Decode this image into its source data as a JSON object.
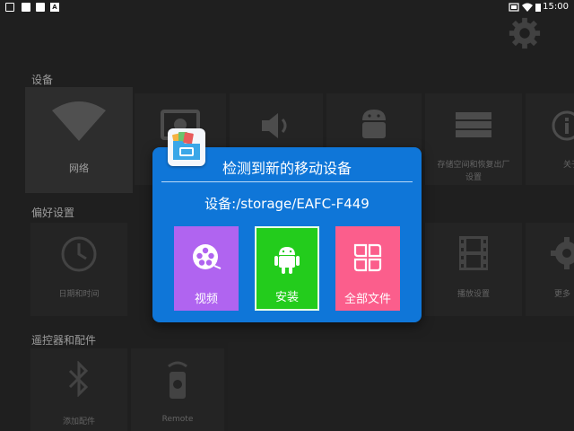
{
  "status_bar": {
    "left_badge_text": "A",
    "time": "15:00"
  },
  "sections": {
    "device": "设备",
    "preferences": "偏好设置",
    "remote": "遥控器和配件"
  },
  "device_tiles": [
    {
      "label": "网络",
      "icon": "wifi-icon"
    },
    {
      "label": "",
      "icon": "display-icon"
    },
    {
      "label": "",
      "icon": "volume-icon"
    },
    {
      "label": "",
      "icon": "android-icon"
    },
    {
      "label": "存储空间和恢复出厂设置",
      "label_line1": "存储空间和恢复出厂",
      "label_line2": "设置",
      "icon": "storage-icon"
    },
    {
      "label": "关于",
      "label_partial": "关于",
      "icon": "info-icon"
    }
  ],
  "preference_tiles": [
    {
      "label": "日期和时间",
      "icon": "clock-icon"
    },
    {
      "label": "播放设置",
      "icon": "film-icon"
    },
    {
      "label": "更多设置",
      "label_partial": "更多",
      "icon": "gear-icon"
    }
  ],
  "remote_tiles": [
    {
      "label": "添加配件",
      "icon": "bluetooth-icon"
    },
    {
      "label": "Remote",
      "icon": "remote-icon"
    }
  ],
  "dialog": {
    "title": "检测到新的移动设备",
    "device": "设备:/storage/EAFC-F449",
    "actions": [
      {
        "label": "视频",
        "icon": "film-reel-icon",
        "color": "#b064f0"
      },
      {
        "label": "安装",
        "icon": "android-icon",
        "color": "#23cc1c",
        "selected": true
      },
      {
        "label": "全部文件",
        "icon": "folder-grid-icon",
        "color": "#fb5e8c"
      }
    ]
  },
  "colors": {
    "dialog_bg": "#0f76d8",
    "background": "#2c2c2c"
  }
}
